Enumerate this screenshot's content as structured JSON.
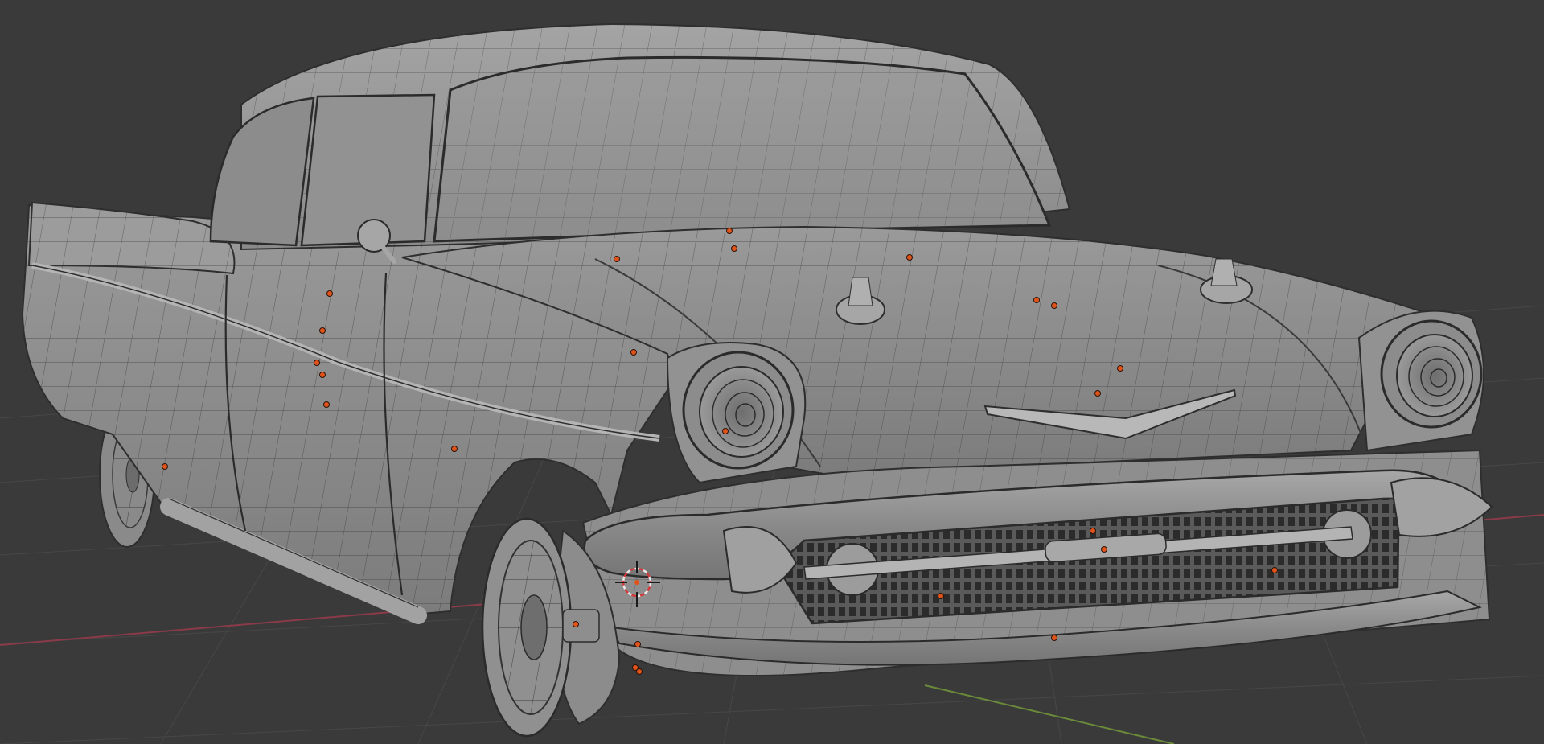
{
  "viewport": {
    "name": "3D Viewport",
    "background": "#3a3a3a",
    "grid_color": "#4a4a4a",
    "x_axis_color": "#8a3a48",
    "y_axis_color": "#6a8a3a",
    "model_name": "car-wireframe-model",
    "mesh_color": "#8e8e8e",
    "edge_color": "#2e2e2e",
    "vertex_marker_color": "#e0531a"
  },
  "icons": {
    "cursor": "3d-cursor-icon"
  }
}
